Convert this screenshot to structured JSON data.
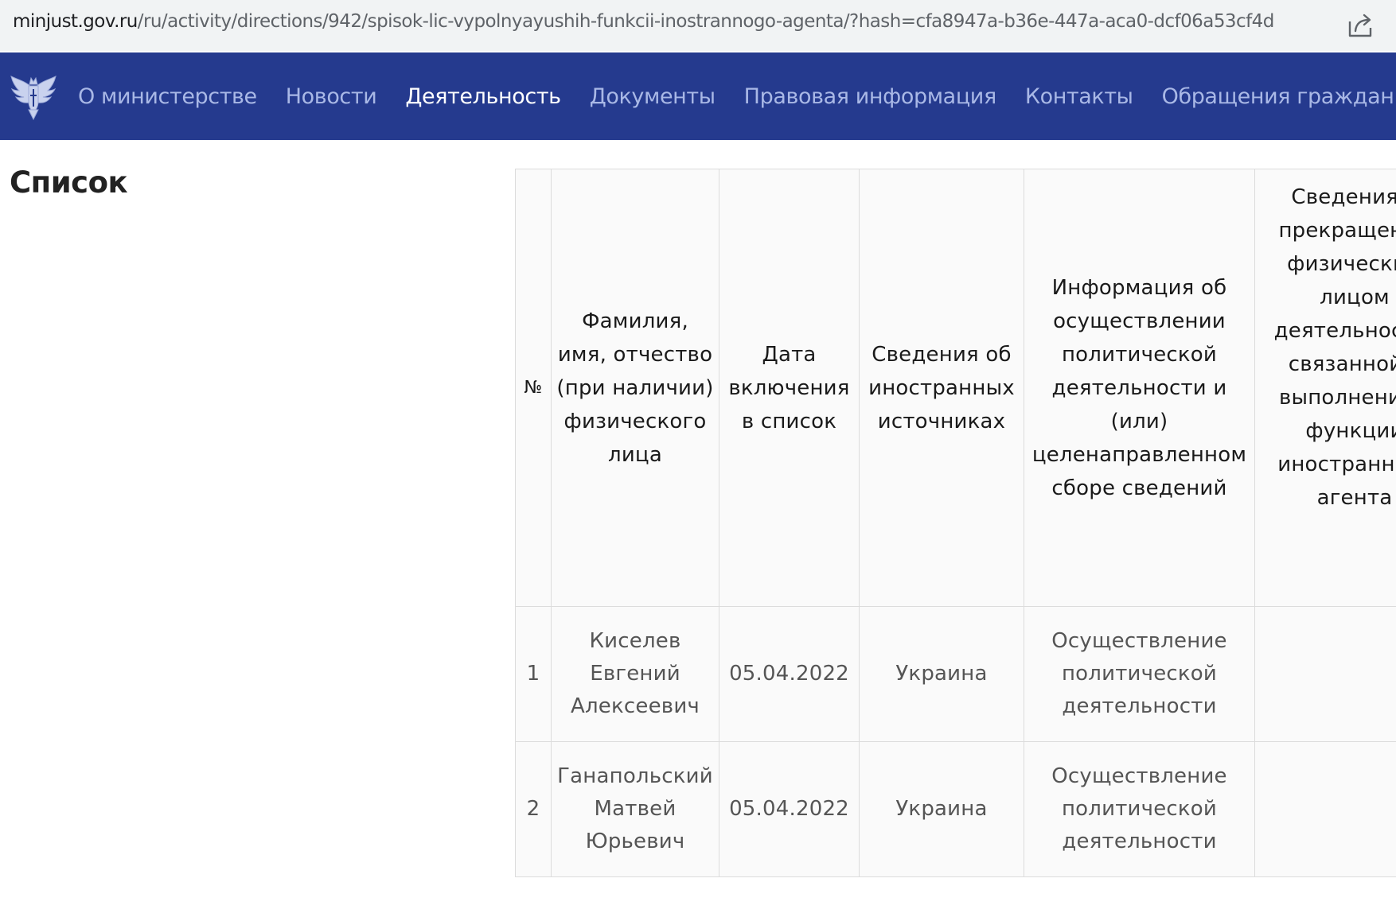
{
  "browser": {
    "url_host": "minjust.gov.ru",
    "url_path": "/ru/activity/directions/942/spisok-lic-vypolnyayushih-funkcii-inostrannogo-agenta/?hash=cfa8947a-b36e-447a-aca0-dcf06a53cf4d",
    "share_icon": "share-icon"
  },
  "nav": {
    "background": "#253a8e",
    "active_color": "#ffffff",
    "inactive_color": "#a9b8e6",
    "logo_icon": "emblem-icon",
    "items": [
      {
        "label": "О министерстве",
        "active": false
      },
      {
        "label": "Новости",
        "active": false
      },
      {
        "label": "Деятельность",
        "active": true
      },
      {
        "label": "Документы",
        "active": false
      },
      {
        "label": "Правовая информация",
        "active": false
      },
      {
        "label": "Контакты",
        "active": false
      },
      {
        "label": "Обращения граждан",
        "active": false
      }
    ]
  },
  "page": {
    "title": "Список"
  },
  "table": {
    "headers": [
      "№",
      "Фамилия, имя, отчество (при наличии) физического лица",
      "Дата включения в список",
      "Сведения об иностранных источниках",
      "Информация об осуществлении политической деятельности и (или) целенаправленном сборе сведений",
      "Сведения о прекращении физическим лицом деятельности, связанной с выполнением функции иностранного агента"
    ],
    "rows": [
      {
        "num": "1",
        "name": "Киселев Евгений Алексеевич",
        "date": "05.04.2022",
        "source": "Украина",
        "activity": "Осуществление политической деятельности",
        "termination": ""
      },
      {
        "num": "2",
        "name": "Ганапольский Матвей Юрьевич",
        "date": "05.04.2022",
        "source": "Украина",
        "activity": "Осуществление политической деятельности",
        "termination": ""
      }
    ]
  }
}
